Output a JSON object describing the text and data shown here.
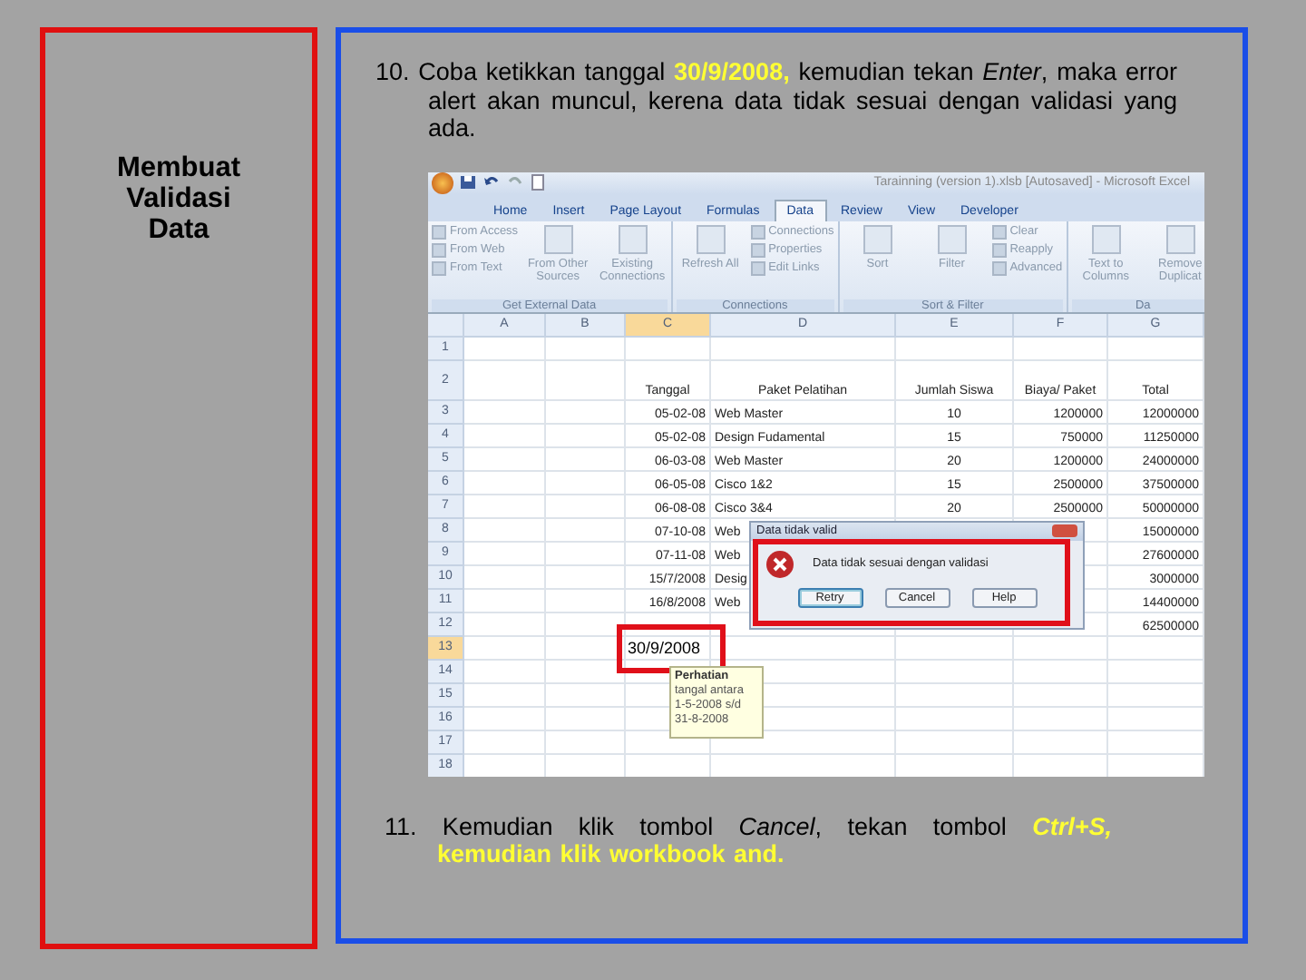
{
  "sidebar": {
    "title": "Membuat Validasi Data"
  },
  "steps": [
    {
      "segments": [
        {
          "text": "10. Coba ketikkan tanggal ",
          "kind": "plain"
        },
        {
          "text": "30/9/2008,",
          "kind": "highlight"
        },
        {
          "text": " kemudian tekan ",
          "kind": "plain"
        },
        {
          "text": "Enter",
          "kind": "italic"
        },
        {
          "text": ", maka error alert akan muncul, kerena data tidak sesuai dengan validasi yang ada.",
          "kind": "plain"
        }
      ]
    },
    {
      "segments": [
        {
          "text": "11. Kemudian klik tombol ",
          "kind": "plain"
        },
        {
          "text": "Cancel",
          "kind": "italic"
        },
        {
          "text": ", tekan tombol ",
          "kind": "plain"
        },
        {
          "text": "Ctrl+S,",
          "kind": "highlight-italic"
        },
        {
          "text": " kemudian klik workbook and.",
          "kind": "highlight"
        }
      ]
    }
  ],
  "screenshot": {
    "window_title": "Tarainning (version 1).xlsb [Autosaved] - Microsoft Excel",
    "ribbon_tabs": [
      {
        "label": "Home",
        "selected": false
      },
      {
        "label": "Insert",
        "selected": false
      },
      {
        "label": "Page Layout",
        "selected": false
      },
      {
        "label": "Formulas",
        "selected": false
      },
      {
        "label": "Data",
        "selected": true
      },
      {
        "label": "Review",
        "selected": false
      },
      {
        "label": "View",
        "selected": false
      },
      {
        "label": "Developer",
        "selected": false
      }
    ],
    "ribbon_groups": [
      {
        "label": "Get External Data",
        "commands": [
          {
            "label": "From Access",
            "kind": "small"
          },
          {
            "label": "From Web",
            "kind": "small"
          },
          {
            "label": "From Text",
            "kind": "small"
          },
          {
            "label": "From Other Sources",
            "kind": "large"
          },
          {
            "label": "Existing Connections",
            "kind": "large"
          }
        ]
      },
      {
        "label": "Connections",
        "commands": [
          {
            "label": "Refresh All",
            "kind": "large"
          },
          {
            "label": "Connections",
            "kind": "small"
          },
          {
            "label": "Properties",
            "kind": "small"
          },
          {
            "label": "Edit Links",
            "kind": "small"
          }
        ]
      },
      {
        "label": "Sort & Filter",
        "commands": [
          {
            "label": "Sort",
            "kind": "large"
          },
          {
            "label": "Filter",
            "kind": "large"
          },
          {
            "label": "Clear",
            "kind": "small"
          },
          {
            "label": "Reapply",
            "kind": "small"
          },
          {
            "label": "Advanced",
            "kind": "small"
          }
        ]
      },
      {
        "label": "Da",
        "commands": [
          {
            "label": "Text to Columns",
            "kind": "large"
          },
          {
            "label": "Remove Duplicat",
            "kind": "large"
          }
        ]
      }
    ],
    "columns": [
      {
        "label": "A",
        "selected": false
      },
      {
        "label": "B",
        "selected": false
      },
      {
        "label": "C",
        "selected": true
      },
      {
        "label": "D",
        "selected": false
      },
      {
        "label": "E",
        "selected": false
      },
      {
        "label": "F",
        "selected": false
      },
      {
        "label": "G",
        "selected": false
      }
    ],
    "rows": [
      {
        "label": "1",
        "selected": false,
        "kind": "data",
        "cells": {}
      },
      {
        "label": "2",
        "selected": false,
        "kind": "header",
        "cells": {
          "c": "Tanggal",
          "d": "Paket Pelatihan",
          "e": "Jumlah Siswa",
          "f": "Biaya/ Paket",
          "g": "Total"
        }
      },
      {
        "label": "3",
        "selected": false,
        "kind": "data",
        "cells": {
          "c": "05-02-08",
          "d": "Web Master",
          "e": "10",
          "f": "1200000",
          "g": "12000000"
        }
      },
      {
        "label": "4",
        "selected": false,
        "kind": "data",
        "cells": {
          "c": "05-02-08",
          "d": "Design Fudamental",
          "e": "15",
          "f": "750000",
          "g": "11250000"
        }
      },
      {
        "label": "5",
        "selected": false,
        "kind": "data",
        "cells": {
          "c": "06-03-08",
          "d": "Web Master",
          "e": "20",
          "f": "1200000",
          "g": "24000000"
        }
      },
      {
        "label": "6",
        "selected": false,
        "kind": "data",
        "cells": {
          "c": "06-05-08",
          "d": "Cisco 1&2",
          "e": "15",
          "f": "2500000",
          "g": "37500000"
        }
      },
      {
        "label": "7",
        "selected": false,
        "kind": "data",
        "cells": {
          "c": "06-08-08",
          "d": "Cisco 3&4",
          "e": "20",
          "f": "2500000",
          "g": "50000000"
        }
      },
      {
        "label": "8",
        "selected": false,
        "kind": "data",
        "cells": {
          "c": "07-10-08",
          "d": "Web",
          "g": "15000000"
        }
      },
      {
        "label": "9",
        "selected": false,
        "kind": "data",
        "cells": {
          "c": "07-11-08",
          "d": "Web",
          "g": "27600000"
        }
      },
      {
        "label": "10",
        "selected": false,
        "kind": "data",
        "cells": {
          "c": "15/7/2008",
          "d": "Desig",
          "g": "3000000"
        }
      },
      {
        "label": "11",
        "selected": false,
        "kind": "data",
        "cells": {
          "c": "16/8/2008",
          "d": "Web",
          "g": "14400000"
        }
      },
      {
        "label": "12",
        "selected": false,
        "kind": "data",
        "cells": {
          "g": "62500000"
        }
      },
      {
        "label": "13",
        "selected": true,
        "kind": "editing",
        "cells": {
          "c": "30/9/2008"
        }
      },
      {
        "label": "14",
        "selected": false,
        "kind": "data",
        "cells": {}
      },
      {
        "label": "15",
        "selected": false,
        "kind": "data",
        "cells": {}
      },
      {
        "label": "16",
        "selected": false,
        "kind": "data",
        "cells": {}
      },
      {
        "label": "17",
        "selected": false,
        "kind": "data",
        "cells": {}
      },
      {
        "label": "18",
        "selected": false,
        "kind": "data",
        "cells": {}
      }
    ],
    "dialog": {
      "title": "Data tidak valid",
      "message": "Data tidak sesuai dengan validasi",
      "buttons": [
        {
          "label": "Retry",
          "selected": true
        },
        {
          "label": "Cancel",
          "selected": false
        },
        {
          "label": "Help",
          "selected": false
        }
      ]
    },
    "tooltip": {
      "title": "Perhatian",
      "lines": [
        "tangal antara",
        "1-5-2008 s/d",
        "31-8-2008"
      ]
    }
  }
}
